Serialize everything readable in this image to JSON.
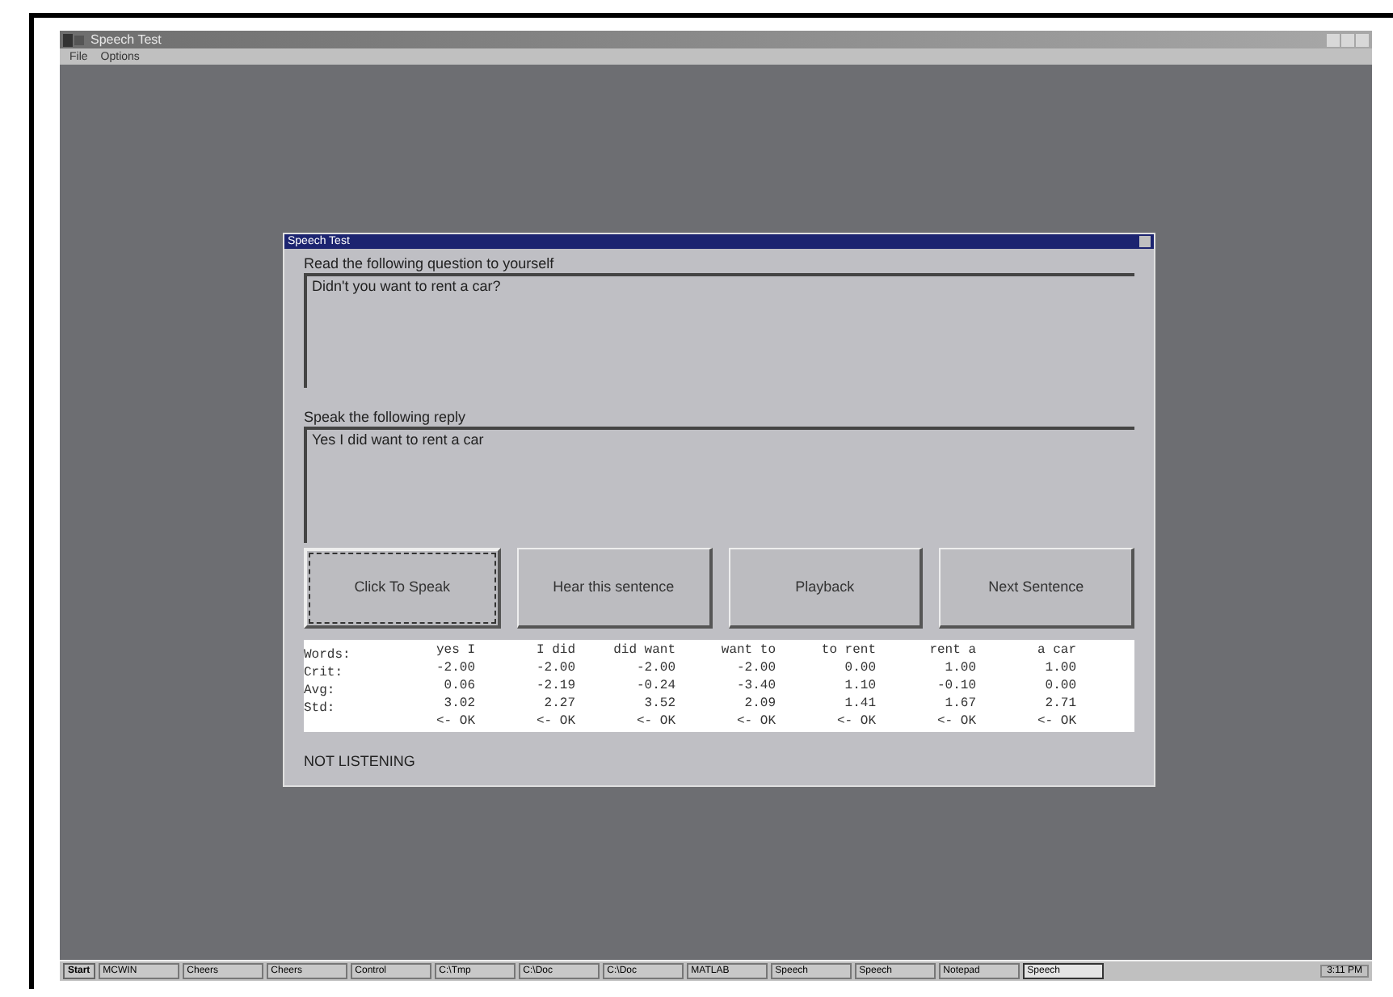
{
  "window": {
    "title": "Speech Test",
    "menu": [
      "File",
      "Options"
    ]
  },
  "dialog": {
    "title": "Speech Test",
    "question_label": "Read the following question to yourself",
    "question": "Didn't you want to rent a car?",
    "reply_label": "Speak the following reply",
    "reply": "Yes I did want to rent a car",
    "buttons": [
      {
        "label": "Click To Speak",
        "focused": true
      },
      {
        "label": "Hear this sentence",
        "focused": false
      },
      {
        "label": "Playback",
        "focused": false
      },
      {
        "label": "Next Sentence",
        "focused": false
      }
    ],
    "results": [
      {
        "label": "Words:",
        "cells": [
          "yes I",
          "I did",
          "did want",
          "want to",
          "to rent",
          "rent a",
          "a car"
        ]
      },
      {
        "label": "Crit:",
        "cells": [
          "-2.00",
          "-2.00",
          "-2.00",
          "-2.00",
          "0.00",
          "1.00",
          "1.00"
        ]
      },
      {
        "label": "Avg:",
        "cells": [
          "0.06",
          "-2.19",
          "-0.24",
          "-3.40",
          "1.10",
          "-0.10",
          "0.00"
        ]
      },
      {
        "label": "Std:",
        "cells": [
          "3.02",
          "2.27",
          "3.52",
          "2.09",
          "1.41",
          "1.67",
          "2.71"
        ]
      },
      {
        "cells": [
          "<- OK",
          "<- OK",
          "<- OK",
          "<- OK",
          "<- OK",
          "<- OK",
          "<- OK"
        ]
      }
    ],
    "status": "NOT LISTENING"
  },
  "taskbar": {
    "start": "Start",
    "tasks": [
      {
        "label": "MCWIN",
        "active": false
      },
      {
        "label": "Cheers",
        "active": false
      },
      {
        "label": "Cheers",
        "active": false
      },
      {
        "label": "Control",
        "active": false
      },
      {
        "label": "C:\\Tmp",
        "active": false
      },
      {
        "label": "C:\\Doc",
        "active": false
      },
      {
        "label": "C:\\Doc",
        "active": false
      },
      {
        "label": "MATLAB",
        "active": false
      },
      {
        "label": "Speech",
        "active": false
      },
      {
        "label": "Speech",
        "active": false
      },
      {
        "label": "Notepad",
        "active": false
      },
      {
        "label": "Speech",
        "active": true
      }
    ],
    "clock": "3:11 PM"
  }
}
